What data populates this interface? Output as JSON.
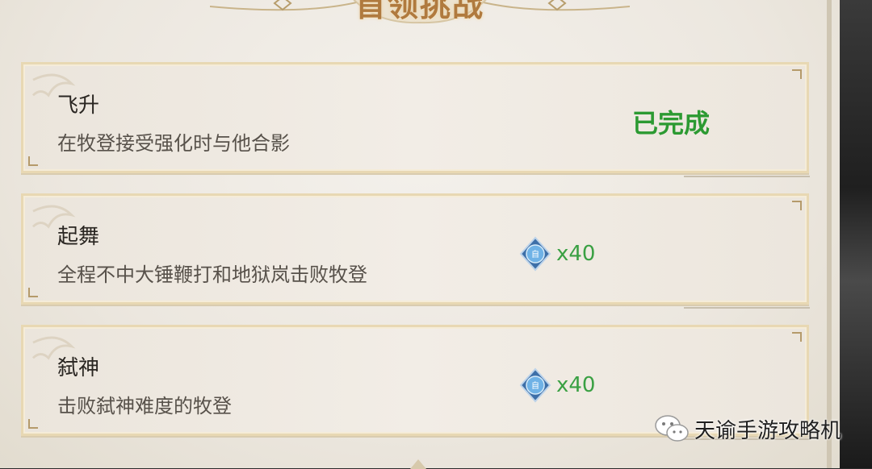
{
  "header": {
    "title": "首领挑战"
  },
  "challenges": [
    {
      "title": "飞升",
      "description": "在牧登接受强化时与他合影",
      "status": "已完成"
    },
    {
      "title": "起舞",
      "description": "全程不中大锤鞭打和地狱岚击败牧登",
      "reward": {
        "icon": "defense-gem-icon",
        "count": "x40"
      }
    },
    {
      "title": "弑神",
      "description": "击败弑神难度的牧登",
      "reward": {
        "icon": "defense-gem-icon",
        "count": "x40"
      }
    }
  ],
  "watermark": {
    "icon": "wechat-icon",
    "text": "天谕手游攻略机"
  },
  "colors": {
    "complete": "#2c9a32",
    "reward_count": "#3aa043",
    "title_gold": "#b07a3e"
  }
}
